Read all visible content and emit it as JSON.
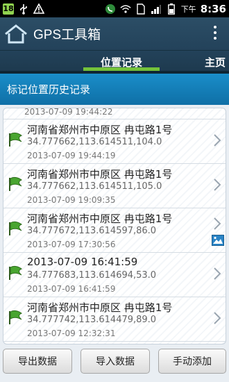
{
  "status_bar": {
    "badge": "18",
    "network": "下午",
    "time": "8:36"
  },
  "app": {
    "title": "GPS工具箱"
  },
  "tabs": {
    "active": "位置记录",
    "other": "主页"
  },
  "section": {
    "title": "标记位置历史记录"
  },
  "list": {
    "partial_top_time": "2013-07-09 19:44:22",
    "items": [
      {
        "title": "河南省郑州市中原区 冉屯路1号",
        "coords": "34.777662,113.614511,104.0",
        "time": "2013-07-09 19:44:19"
      },
      {
        "title": "河南省郑州市中原区 冉屯路1号",
        "coords": "34.777662,113.614511,105.0",
        "time": "2013-07-09 19:09:35"
      },
      {
        "title": "河南省郑州市中原区 冉屯路1号",
        "coords": "34.777672,113.614597,86.0",
        "time": "2013-07-09 17:30:56"
      },
      {
        "title": "2013-07-09 16:41:59",
        "coords": "34.777683,113.614694,53.0",
        "time": "2013-07-09 16:41:59"
      },
      {
        "title": "河南省郑州市中原区 冉屯路1号",
        "coords": "34.777742,113.614479,89.0",
        "time": "2013-07-09 12:32:31"
      }
    ]
  },
  "buttons": {
    "export": "导出数据",
    "import": "导入数据",
    "manual_add": "手动添加"
  },
  "colors": {
    "titlebar": "#2c4e66",
    "tab_indicator": "#74c23a",
    "section_header": "#1a8ec9"
  }
}
